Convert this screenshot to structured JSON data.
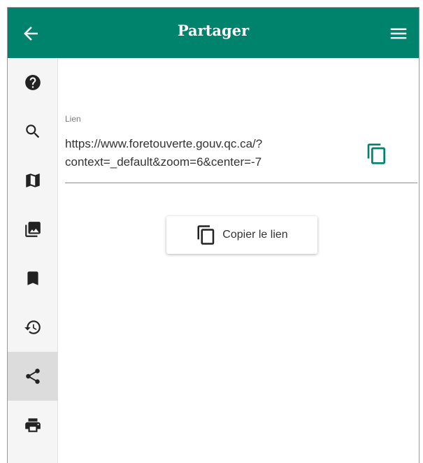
{
  "header": {
    "title": "Partager",
    "back_icon": "arrow-left-icon",
    "menu_icon": "hamburger-menu-icon",
    "color": "#00836c"
  },
  "sidebar": {
    "items": [
      {
        "icon": "help-icon",
        "active": false
      },
      {
        "icon": "search-icon",
        "active": false
      },
      {
        "icon": "map-icon",
        "active": false
      },
      {
        "icon": "image-layers-icon",
        "active": false
      },
      {
        "icon": "bookmark-icon",
        "active": false
      },
      {
        "icon": "history-icon",
        "active": false
      },
      {
        "icon": "share-icon",
        "active": true
      },
      {
        "icon": "print-icon",
        "active": false
      }
    ]
  },
  "share": {
    "link_label": "Lien",
    "link_value": "https://www.foretouverte.gouv.qc.ca/?\ncontext=_default&zoom=6&center=-7",
    "copy_button_label": "Copier le lien",
    "accent_color": "#00836c"
  }
}
